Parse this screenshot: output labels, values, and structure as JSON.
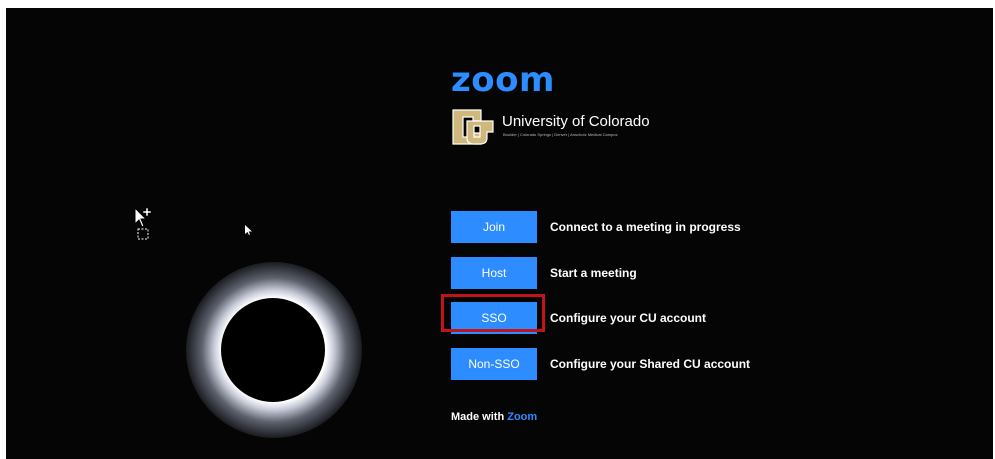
{
  "brand": {
    "logo_text": "zoom",
    "university_name": "University of Colorado",
    "campuses": "Boulder | Colorado Springs | Denver | Anschutz Medical Campus"
  },
  "actions": [
    {
      "label": "Join",
      "description": "Connect to a meeting in progress"
    },
    {
      "label": "Host",
      "description": "Start a meeting"
    },
    {
      "label": "SSO",
      "description": "Configure your CU account"
    },
    {
      "label": "Non-SSO",
      "description": "Configure your Shared CU account"
    }
  ],
  "footer": {
    "prefix": "Made with",
    "brand": "Zoom"
  },
  "colors": {
    "accent": "#2d8cff",
    "background": "#050505",
    "highlight": "#c0141a",
    "cu_gold": "#cfb87c"
  },
  "icons": {
    "cu_logo": "cu-logo-icon",
    "cursor": "cursor-arrow-icon"
  }
}
